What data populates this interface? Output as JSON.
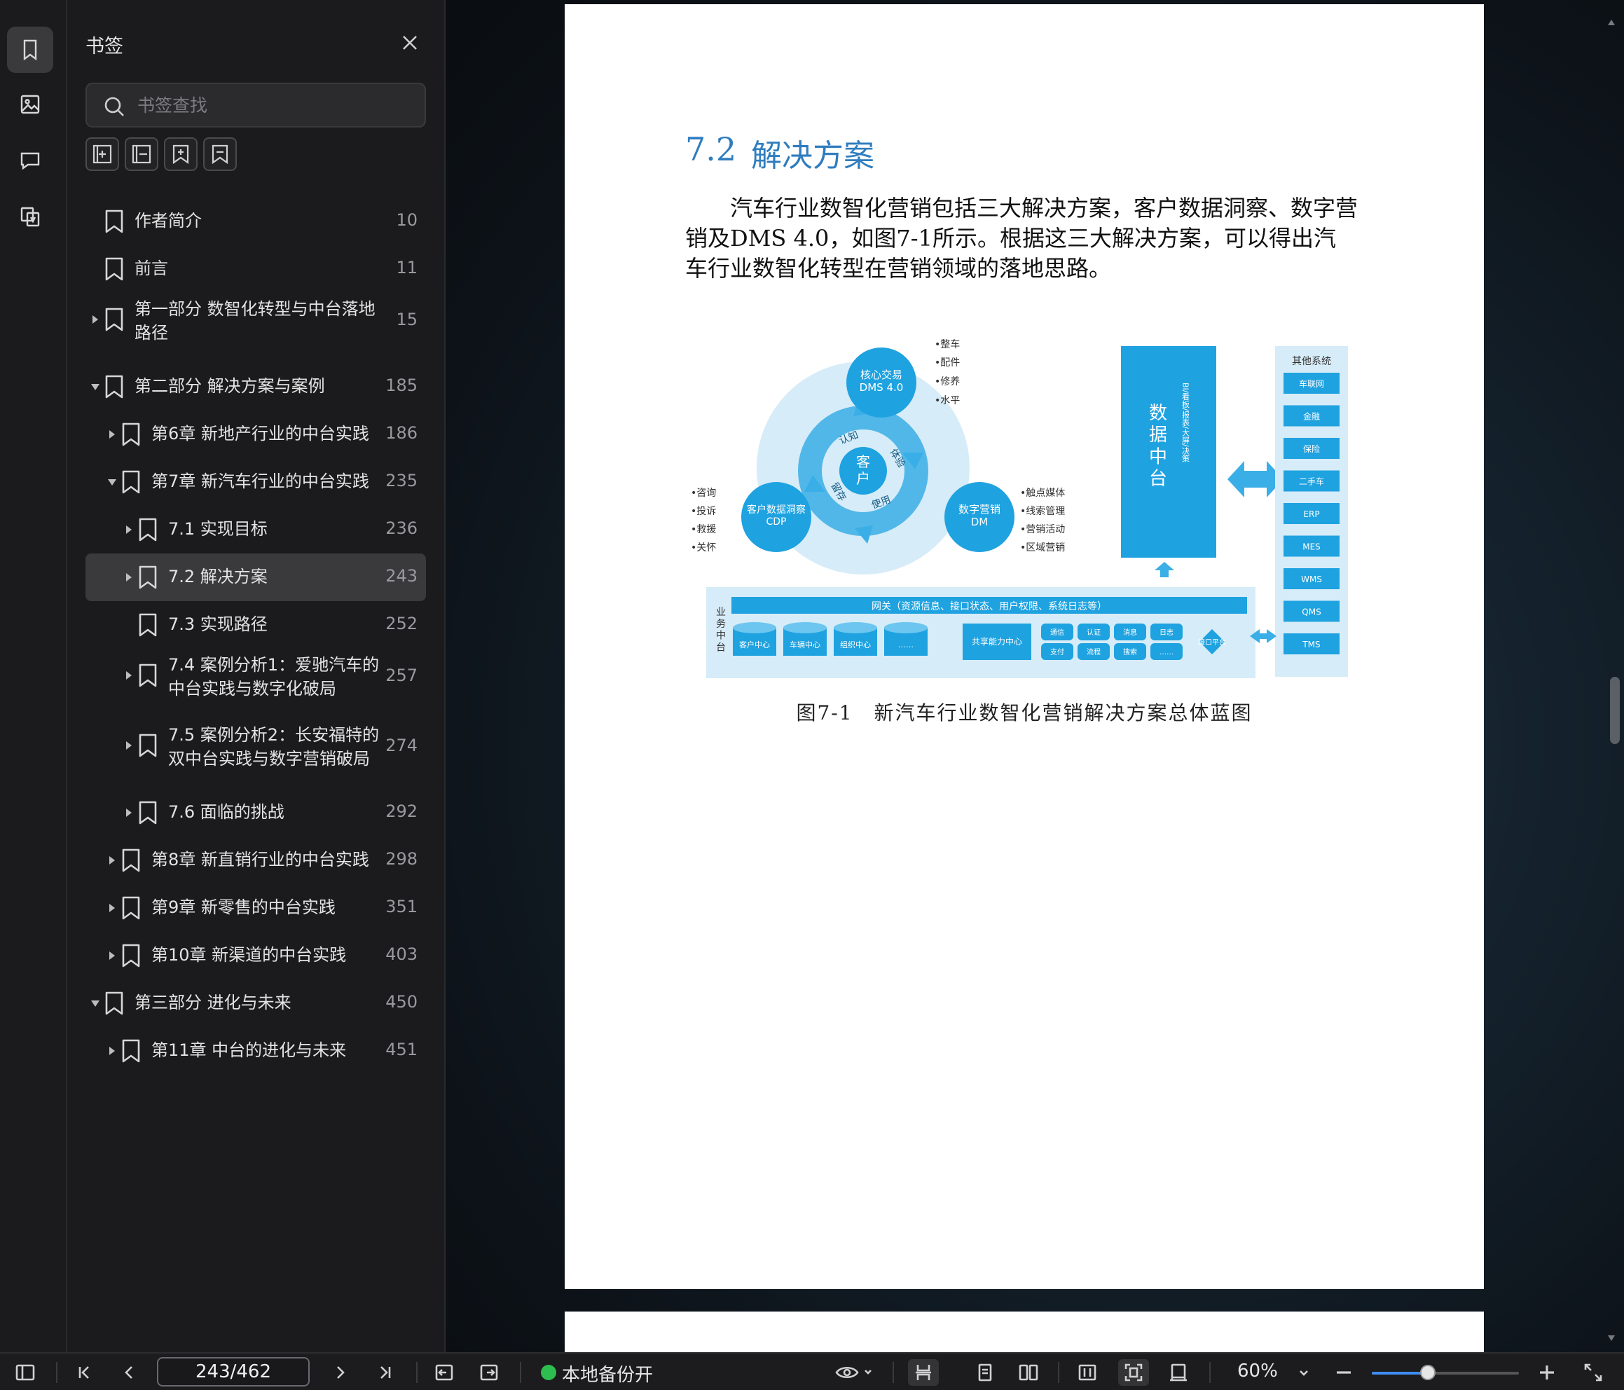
{
  "panel": {
    "title": "书签",
    "search_placeholder": "书签查找"
  },
  "bookmarks": [
    {
      "label": "作者简介",
      "page": "10",
      "level": 0,
      "expander": "none"
    },
    {
      "label": "前言",
      "page": "11",
      "level": 0,
      "expander": "none"
    },
    {
      "label": "第一部分 数智化转型与中台落地\n路径",
      "page": "15",
      "level": 0,
      "expander": "collapsed"
    },
    {
      "label": "第二部分 解决方案与案例",
      "page": "185",
      "level": 0,
      "expander": "expanded"
    },
    {
      "label": "第6章 新地产行业的中台实践",
      "page": "186",
      "level": 1,
      "expander": "collapsed"
    },
    {
      "label": "第7章 新汽车行业的中台实践",
      "page": "235",
      "level": 1,
      "expander": "expanded"
    },
    {
      "label": "7.1 实现目标",
      "page": "236",
      "level": 2,
      "expander": "collapsed"
    },
    {
      "label": "7.2 解决方案",
      "page": "243",
      "level": 2,
      "expander": "collapsed",
      "selected": true
    },
    {
      "label": "7.3 实现路径",
      "page": "252",
      "level": 2,
      "expander": "none"
    },
    {
      "label": "7.4 案例分析1：爱驰汽车的\n中台实践与数字化破局",
      "page": "257",
      "level": 2,
      "expander": "collapsed"
    },
    {
      "label": "7.5 案例分析2：长安福特的\n双中台实践与数字营销破局",
      "page": "274",
      "level": 2,
      "expander": "collapsed"
    },
    {
      "label": "7.6 面临的挑战",
      "page": "292",
      "level": 2,
      "expander": "collapsed"
    },
    {
      "label": "第8章 新直销行业的中台实践",
      "page": "298",
      "level": 1,
      "expander": "collapsed"
    },
    {
      "label": "第9章 新零售的中台实践",
      "page": "351",
      "level": 1,
      "expander": "collapsed"
    },
    {
      "label": "第10章 新渠道的中台实践",
      "page": "403",
      "level": 1,
      "expander": "collapsed"
    },
    {
      "label": "第三部分 进化与未来",
      "page": "450",
      "level": 0,
      "expander": "expanded"
    },
    {
      "label": "第11章 中台的进化与未来",
      "page": "451",
      "level": 1,
      "expander": "collapsed"
    }
  ],
  "document": {
    "section_number": "7.2",
    "section_title": "解决方案",
    "paragraph": "汽车行业数智化营销包括三大解决方案，客户数据洞察、数字营销及DMS 4.0，如图7-1所示。根据这三大解决方案，可以得出汽车行业数智化转型在营销领域的落地思路。",
    "figure": {
      "top_node": "核心交易\nDMS 4.0",
      "left_node": "客户数据洞察\nCDP",
      "right_node": "数字营销\nDM",
      "center": "客\n户",
      "ring_labels": [
        "认知",
        "体验",
        "使用",
        "留存"
      ],
      "top_bullets": [
        "•整车",
        "•配件",
        "•修养",
        "•水平"
      ],
      "left_bullets": [
        "•咨询",
        "•投诉",
        "•救援",
        "•关怀"
      ],
      "right_bullets": [
        "•触点媒体",
        "•线索管理",
        "•营销活动",
        "•区域营销"
      ],
      "data_platform": "数\n据\n中\n台",
      "data_platform_side": "BI/看板/报表/大屏/决策",
      "other_systems_title": "其他系统",
      "other_systems": [
        "车联网",
        "金融",
        "保险",
        "二手车",
        "ERP",
        "MES",
        "WMS",
        "QMS",
        "TMS"
      ],
      "business_platform": "业\n务\n中\n台",
      "gateway": "网关（资源信息、接口状态、用户权限、系统日志等）",
      "centers": [
        "客户中心",
        "车辆中心",
        "组织中心",
        "……"
      ],
      "shared": "共享能力中心",
      "tiles": [
        "通信",
        "认证",
        "消息",
        "日志",
        "支付",
        "流程",
        "搜索",
        "……"
      ],
      "interface_platform": "接口平台"
    },
    "caption": "图7-1　新汽车行业数智化营销解决方案总体蓝图"
  },
  "toolbar": {
    "page_indicator": "243/462",
    "backup_label": "本地备份开",
    "zoom_label": "60%",
    "zoom_percent": 60,
    "backup_status_color": "#2ebd4f"
  }
}
